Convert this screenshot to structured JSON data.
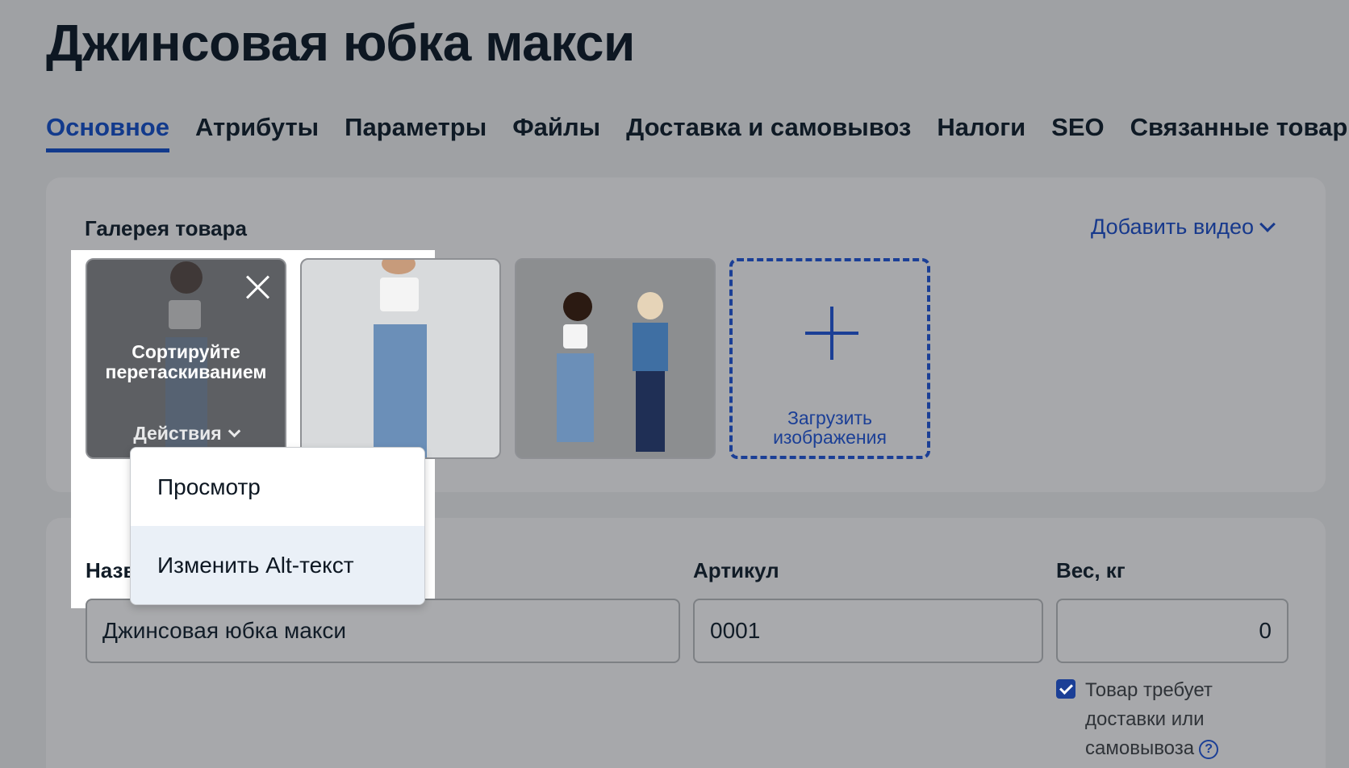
{
  "page": {
    "title": "Джинсовая юбка макси"
  },
  "tabs": [
    {
      "label": "Основное",
      "active": true
    },
    {
      "label": "Атрибуты"
    },
    {
      "label": "Параметры"
    },
    {
      "label": "Файлы"
    },
    {
      "label": "Доставка и самовывоз"
    },
    {
      "label": "Налоги"
    },
    {
      "label": "SEO"
    },
    {
      "label": "Связанные товары"
    }
  ],
  "gallery": {
    "title": "Галерея товара",
    "add_video": "Добавить видео",
    "sort_hint": "Сортируйте перетаскиванием",
    "actions_label": "Действия",
    "upload_label": "Загрузить изображения"
  },
  "dropdown": {
    "items": [
      "Просмотр",
      "Изменить Alt-текст"
    ]
  },
  "fields": {
    "name_label": "Название",
    "name_value": "Джинсовая юбка макси",
    "sku_label": "Артикул",
    "sku_value": "0001",
    "weight_label": "Вес, кг",
    "weight_value": "0",
    "shipping_checkbox": "Товар требует доставки или самовывоза"
  },
  "colors": {
    "accent": "#1b3f96",
    "overlay_bg": "#9fa1a4"
  }
}
